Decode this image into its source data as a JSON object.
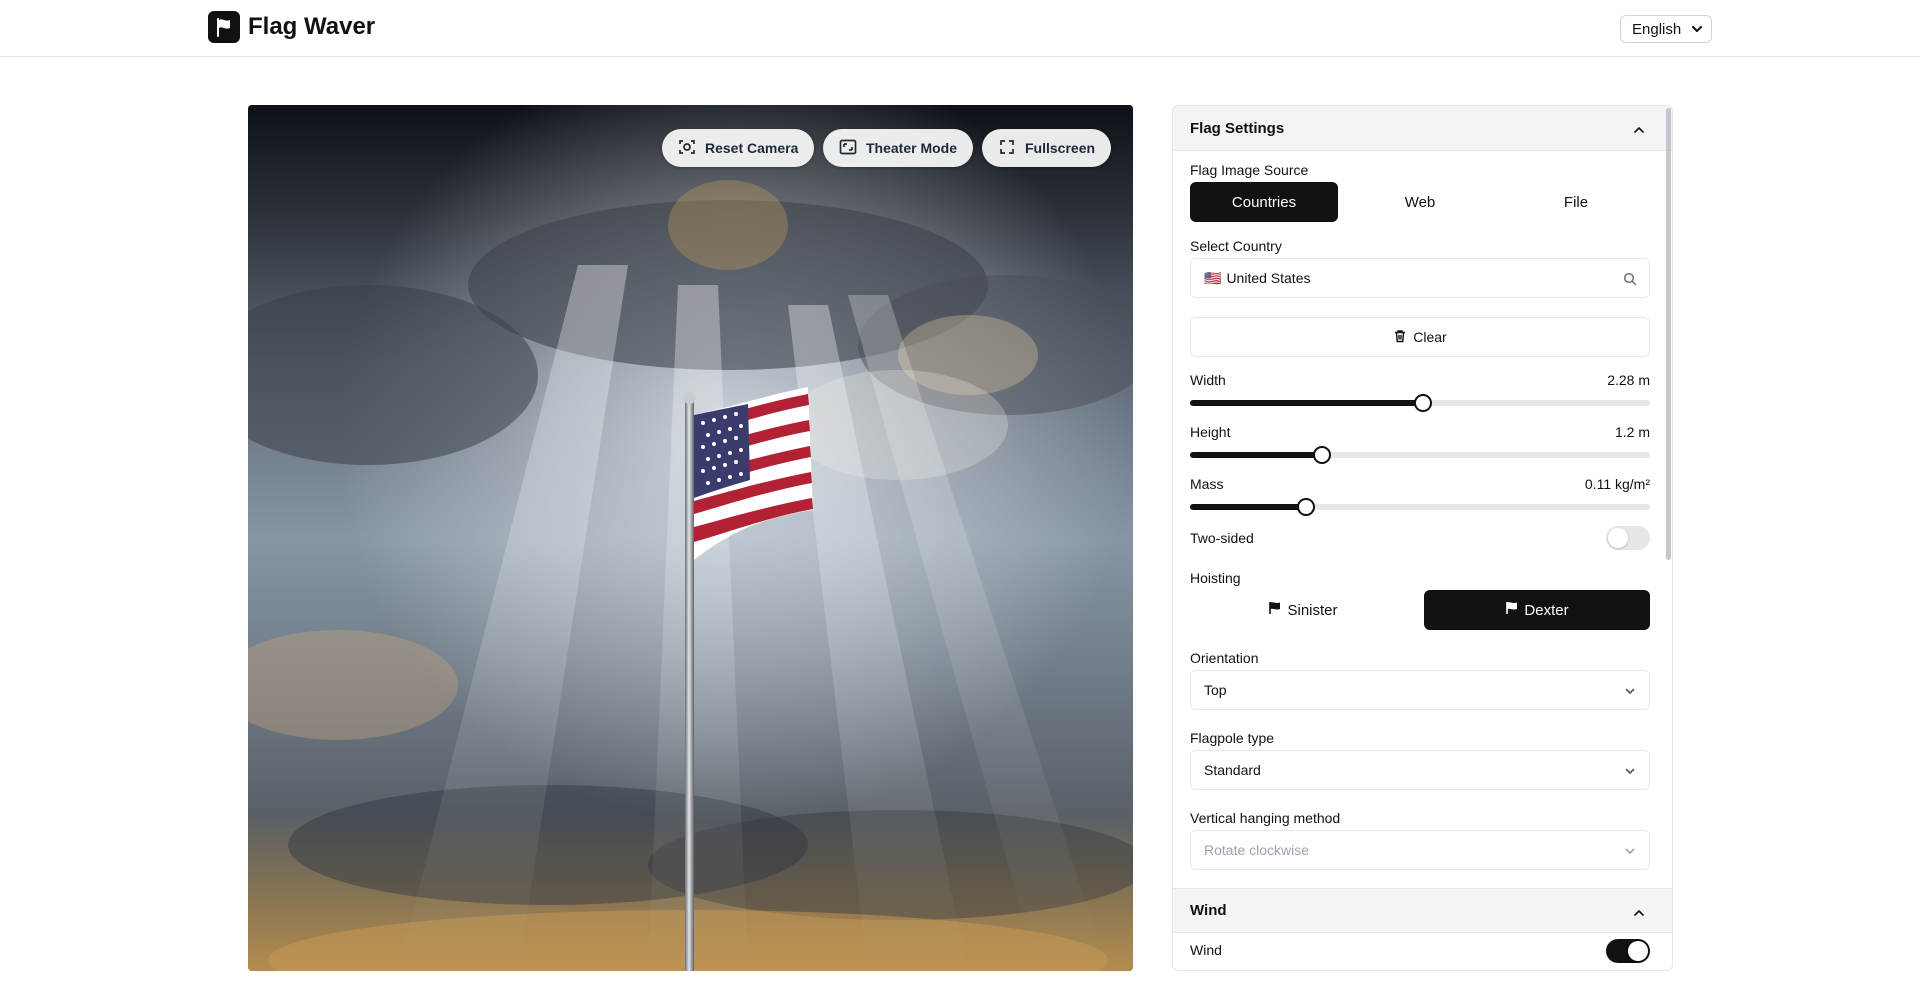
{
  "app": {
    "title": "Flag Waver",
    "language": "English"
  },
  "scene": {
    "buttons": {
      "reset_camera": "Reset Camera",
      "theater_mode": "Theater Mode",
      "fullscreen": "Fullscreen"
    },
    "flag_country": "United States"
  },
  "panel": {
    "flag_settings": {
      "title": "Flag Settings",
      "image_source": {
        "label": "Flag Image Source",
        "options": [
          "Countries",
          "Web",
          "File"
        ],
        "selected": "Countries"
      },
      "country": {
        "label": "Select Country",
        "flag_glyph": "🇺🇸",
        "value": "United States"
      },
      "clear_label": "Clear",
      "width": {
        "label": "Width",
        "value_text": "2.28 m",
        "fraction": 0.507
      },
      "height": {
        "label": "Height",
        "value_text": "1.2 m",
        "fraction": 0.288
      },
      "mass": {
        "label": "Mass",
        "value_text": "0.11 kg/m²",
        "fraction": 0.252
      },
      "two_sided": {
        "label": "Two-sided",
        "on": false
      },
      "hoisting": {
        "label": "Hoisting",
        "options": [
          "Sinister",
          "Dexter"
        ],
        "selected": "Dexter"
      },
      "orientation": {
        "label": "Orientation",
        "value": "Top"
      },
      "flagpole_type": {
        "label": "Flagpole type",
        "value": "Standard"
      },
      "vertical_hanging": {
        "label": "Vertical hanging method",
        "value": "Rotate clockwise",
        "disabled": true
      }
    },
    "wind": {
      "title": "Wind",
      "wind_toggle": {
        "label": "Wind",
        "on": true
      }
    }
  },
  "colors": {
    "primary": "#111111",
    "border": "#e5e7eb",
    "section_bg": "#f3f4f6"
  },
  "icons": {
    "logo": "flag-logo-icon",
    "language": "chevron-down-icon",
    "reset_camera": "camera-focus-icon",
    "theater_mode": "theater-icon",
    "fullscreen": "fullscreen-icon",
    "search": "search-icon",
    "clear": "trash-icon",
    "hoisting": "flag-icon",
    "select": "chevron-down-icon",
    "section": "chevron-up-icon"
  }
}
